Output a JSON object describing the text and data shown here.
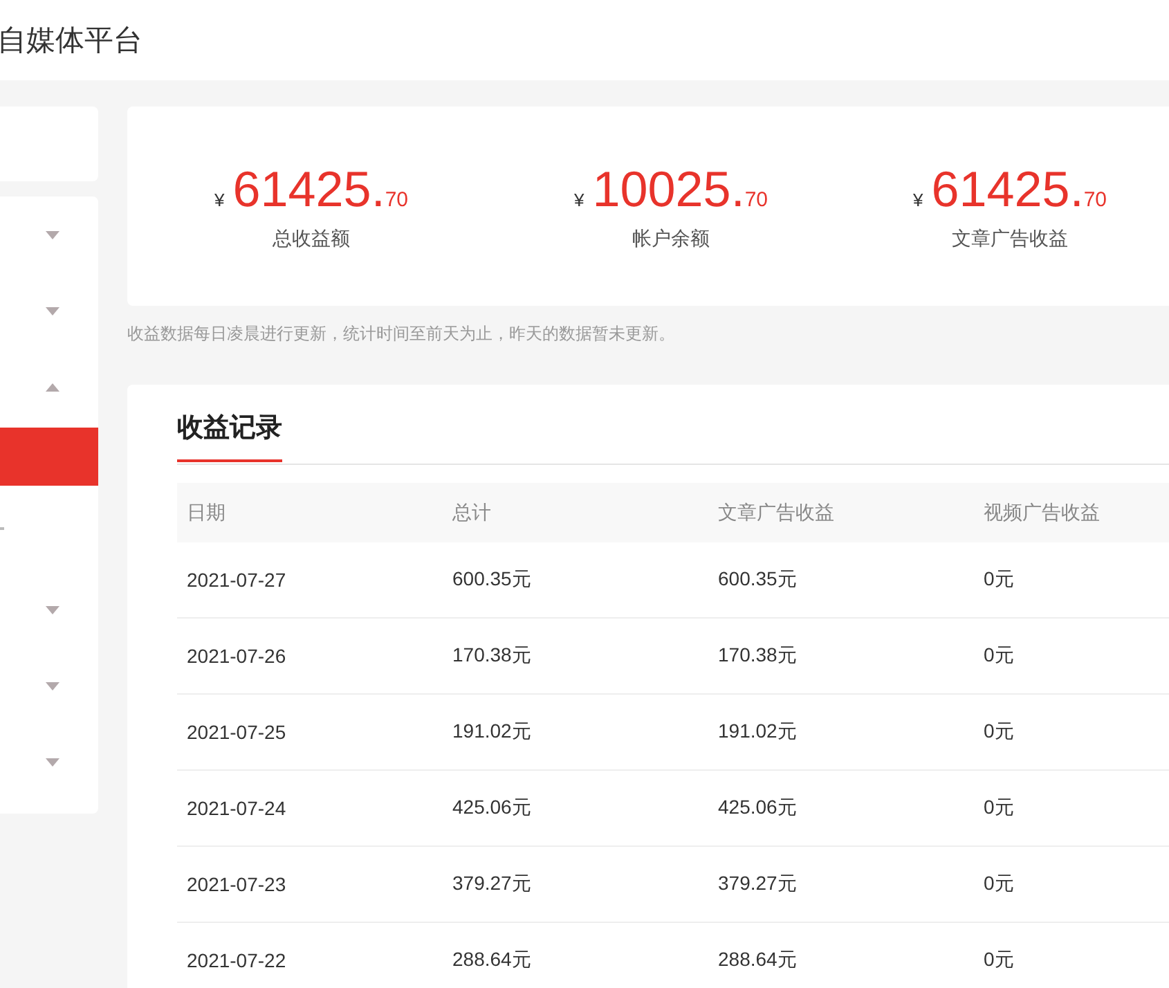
{
  "header": {
    "title": "自媒体平台"
  },
  "sidebar": {
    "items": [
      {
        "expanded": false
      },
      {
        "expanded": false
      },
      {
        "expanded": true,
        "children": [
          {
            "selected": true
          },
          {
            "selected": false
          }
        ]
      },
      {
        "expanded": false
      },
      {
        "expanded": false
      },
      {
        "expanded": false
      }
    ]
  },
  "stats": [
    {
      "currency": "¥",
      "integer": "61425.",
      "decimal": "70",
      "label": "总收益额"
    },
    {
      "currency": "¥",
      "integer": "10025.",
      "decimal": "70",
      "label": "帐户余额"
    },
    {
      "currency": "¥",
      "integer": "61425.",
      "decimal": "70",
      "label": "文章广告收益"
    }
  ],
  "note": "收益数据每日凌晨进行更新，统计时间至前天为止，昨天的数据暂未更新。",
  "records": {
    "tab": "收益记录",
    "columns": [
      "日期",
      "总计",
      "文章广告收益",
      "视频广告收益"
    ],
    "rows": [
      [
        "2021-07-27",
        "600.35元",
        "600.35元",
        "0元"
      ],
      [
        "2021-07-26",
        "170.38元",
        "170.38元",
        "0元"
      ],
      [
        "2021-07-25",
        "191.02元",
        "191.02元",
        "0元"
      ],
      [
        "2021-07-24",
        "425.06元",
        "425.06元",
        "0元"
      ],
      [
        "2021-07-23",
        "379.27元",
        "379.27元",
        "0元"
      ],
      [
        "2021-07-22",
        "288.64元",
        "288.64元",
        "0元"
      ]
    ]
  }
}
